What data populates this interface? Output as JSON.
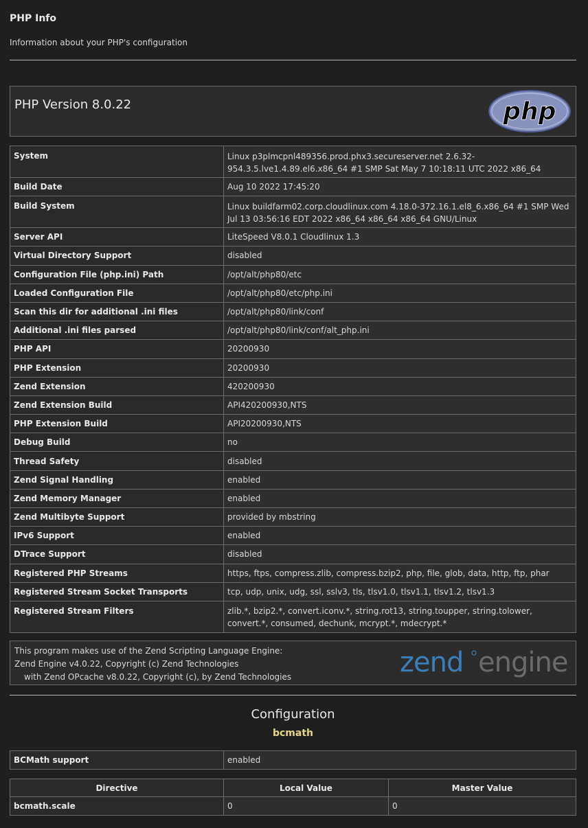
{
  "header": {
    "title": "PHP Info",
    "subtitle": "Information about your PHP's configuration"
  },
  "version": {
    "title": "PHP Version 8.0.22",
    "logo_text": "php"
  },
  "info_rows": [
    {
      "name": "System",
      "value": "Linux p3plmcpnl489356.prod.phx3.secureserver.net 2.6.32-954.3.5.lve1.4.89.el6.x86_64 #1 SMP Sat May 7 10:18:11 UTC 2022 x86_64"
    },
    {
      "name": "Build Date",
      "value": "Aug 10 2022 17:45:20"
    },
    {
      "name": "Build System",
      "value": "Linux buildfarm02.corp.cloudlinux.com 4.18.0-372.16.1.el8_6.x86_64 #1 SMP Wed Jul 13 03:56:16 EDT 2022 x86_64 x86_64 x86_64 GNU/Linux"
    },
    {
      "name": "Server API",
      "value": "LiteSpeed V8.0.1 Cloudlinux 1.3"
    },
    {
      "name": "Virtual Directory Support",
      "value": "disabled"
    },
    {
      "name": "Configuration File (php.ini) Path",
      "value": "/opt/alt/php80/etc"
    },
    {
      "name": "Loaded Configuration File",
      "value": "/opt/alt/php80/etc/php.ini"
    },
    {
      "name": "Scan this dir for additional .ini files",
      "value": "/opt/alt/php80/link/conf"
    },
    {
      "name": "Additional .ini files parsed",
      "value": "/opt/alt/php80/link/conf/alt_php.ini"
    },
    {
      "name": "PHP API",
      "value": "20200930"
    },
    {
      "name": "PHP Extension",
      "value": "20200930"
    },
    {
      "name": "Zend Extension",
      "value": "420200930"
    },
    {
      "name": "Zend Extension Build",
      "value": "API420200930,NTS"
    },
    {
      "name": "PHP Extension Build",
      "value": "API20200930,NTS"
    },
    {
      "name": "Debug Build",
      "value": "no"
    },
    {
      "name": "Thread Safety",
      "value": "disabled"
    },
    {
      "name": "Zend Signal Handling",
      "value": "enabled"
    },
    {
      "name": "Zend Memory Manager",
      "value": "enabled"
    },
    {
      "name": "Zend Multibyte Support",
      "value": "provided by mbstring"
    },
    {
      "name": "IPv6 Support",
      "value": "enabled"
    },
    {
      "name": "DTrace Support",
      "value": "disabled"
    },
    {
      "name": "Registered PHP Streams",
      "value": "https, ftps, compress.zlib, compress.bzip2, php, file, glob, data, http, ftp, phar"
    },
    {
      "name": "Registered Stream Socket Transports",
      "value": "tcp, udp, unix, udg, ssl, sslv3, tls, tlsv1.0, tlsv1.1, tlsv1.2, tlsv1.3"
    },
    {
      "name": "Registered Stream Filters",
      "value": "zlib.*, bzip2.*, convert.iconv.*, string.rot13, string.toupper, string.tolower, convert.*, consumed, dechunk, mcrypt.*, mdecrypt.*"
    }
  ],
  "zend": {
    "line1": "This program makes use of the Zend Scripting Language Engine:",
    "line2": "Zend Engine v4.0.22, Copyright (c) Zend Technologies",
    "line3": "with Zend OPcache v8.0.22, Copyright (c), by Zend Technologies",
    "logo_word1": "zend",
    "logo_word2": "engine"
  },
  "configuration": {
    "title": "Configuration",
    "module": "bcmath",
    "support_name": "BCMath support",
    "support_value": "enabled",
    "directive_headers": [
      "Directive",
      "Local Value",
      "Master Value"
    ],
    "directives": [
      {
        "name": "bcmath.scale",
        "local": "0",
        "master": "0"
      }
    ]
  },
  "colors": {
    "background": "#1f1f1f",
    "cell": "#2f2f2f",
    "border": "#6b6b6b",
    "php_logo": "#8892bf",
    "zend_logo": "#3a7fb8",
    "module_heading": "#e6d68a"
  }
}
